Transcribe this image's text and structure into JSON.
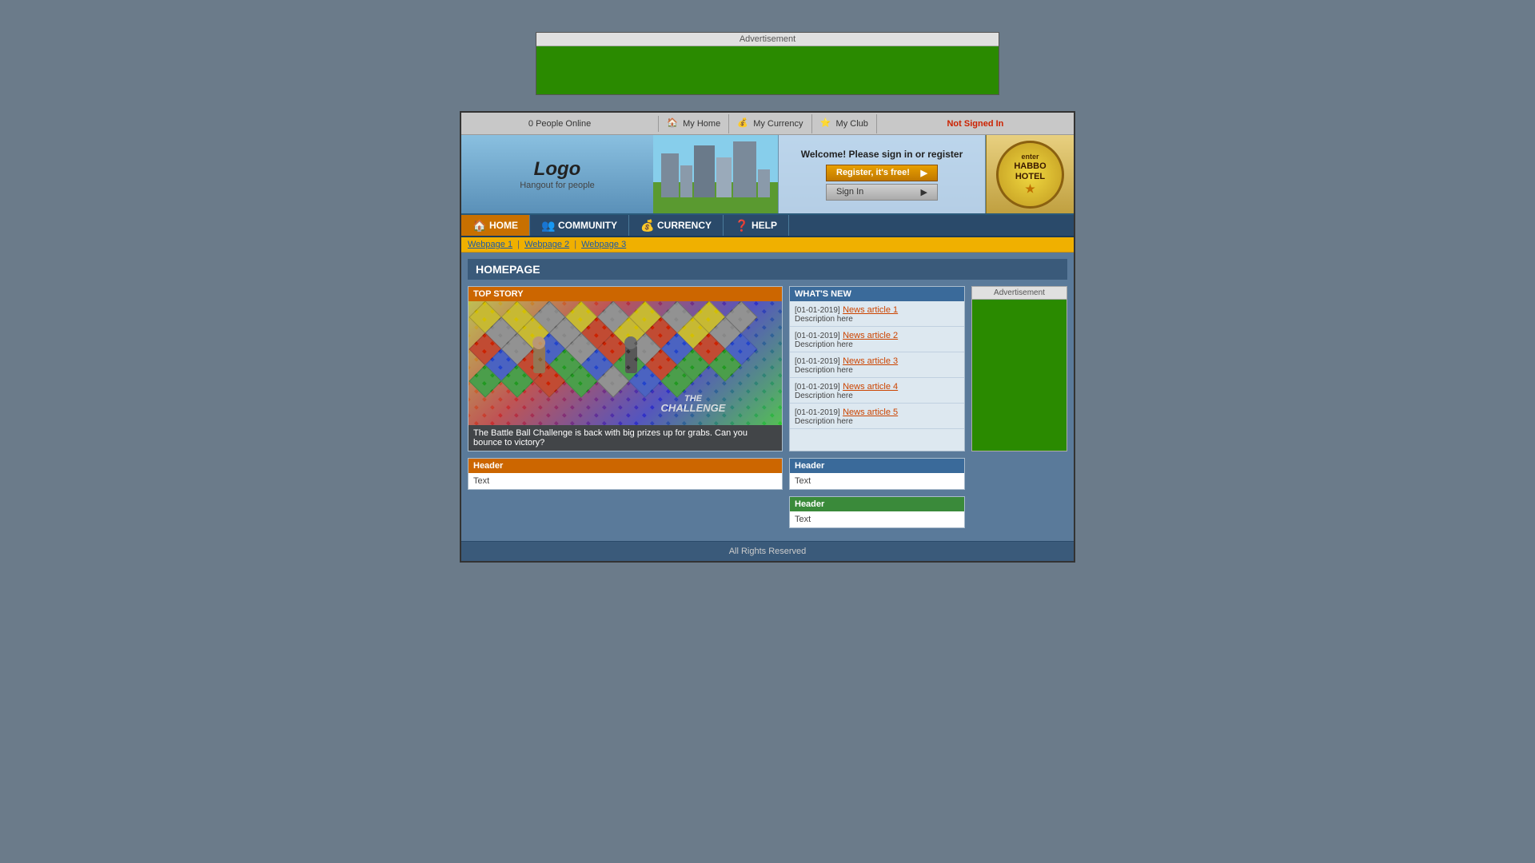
{
  "topAd": {
    "label": "Advertisement"
  },
  "topNav": {
    "peopleOnline": "0 People Online",
    "myHome": "My Home",
    "myCurrency": "My Currency",
    "myClub": "My Club",
    "notSignedIn": "Not Signed In"
  },
  "header": {
    "logoTitle": "Logo",
    "logoSubtitle": "Hangout for people",
    "welcomeText": "Welcome! Please sign in or register",
    "registerBtn": "Register, it's free!",
    "signInBtn": "Sign In",
    "enterHotelLine1": "enter",
    "enterHotelLine2": "HABBO HOTEL"
  },
  "mainNav": {
    "home": "HOME",
    "community": "COMMUNITY",
    "currency": "CURRENCY",
    "help": "HELP"
  },
  "breadcrumb": {
    "page1": "Webpage 1",
    "page2": "Webpage 2",
    "page3": "Webpage 3"
  },
  "pageTitle": "HOMEPAGE",
  "topStory": {
    "header": "TOP STORY",
    "caption": "The Battle Ball Challenge is back with big prizes up for grabs. Can you bounce to victory?",
    "logo": "THE\nCHALLENGE"
  },
  "whatsNew": {
    "header": "WHAT'S NEW",
    "items": [
      {
        "date": "[01-01-2019]",
        "link": "News article 1",
        "desc": "Description here"
      },
      {
        "date": "[01-01-2019]",
        "link": "News article 2",
        "desc": "Description here"
      },
      {
        "date": "[01-01-2019]",
        "link": "News article 3",
        "desc": "Description here"
      },
      {
        "date": "[01-01-2019]",
        "link": "News article 4",
        "desc": "Description here"
      },
      {
        "date": "[01-01-2019]",
        "link": "News article 5",
        "desc": "Description here"
      }
    ]
  },
  "sideAd": {
    "label": "Advertisement"
  },
  "bottomSections": {
    "leftHeader": "Header",
    "leftText": "Text",
    "rightHeader1": "Header",
    "rightText1": "Text",
    "rightHeader2": "Header",
    "rightText2": "Text"
  },
  "footer": {
    "text": "All Rights Reserved"
  }
}
